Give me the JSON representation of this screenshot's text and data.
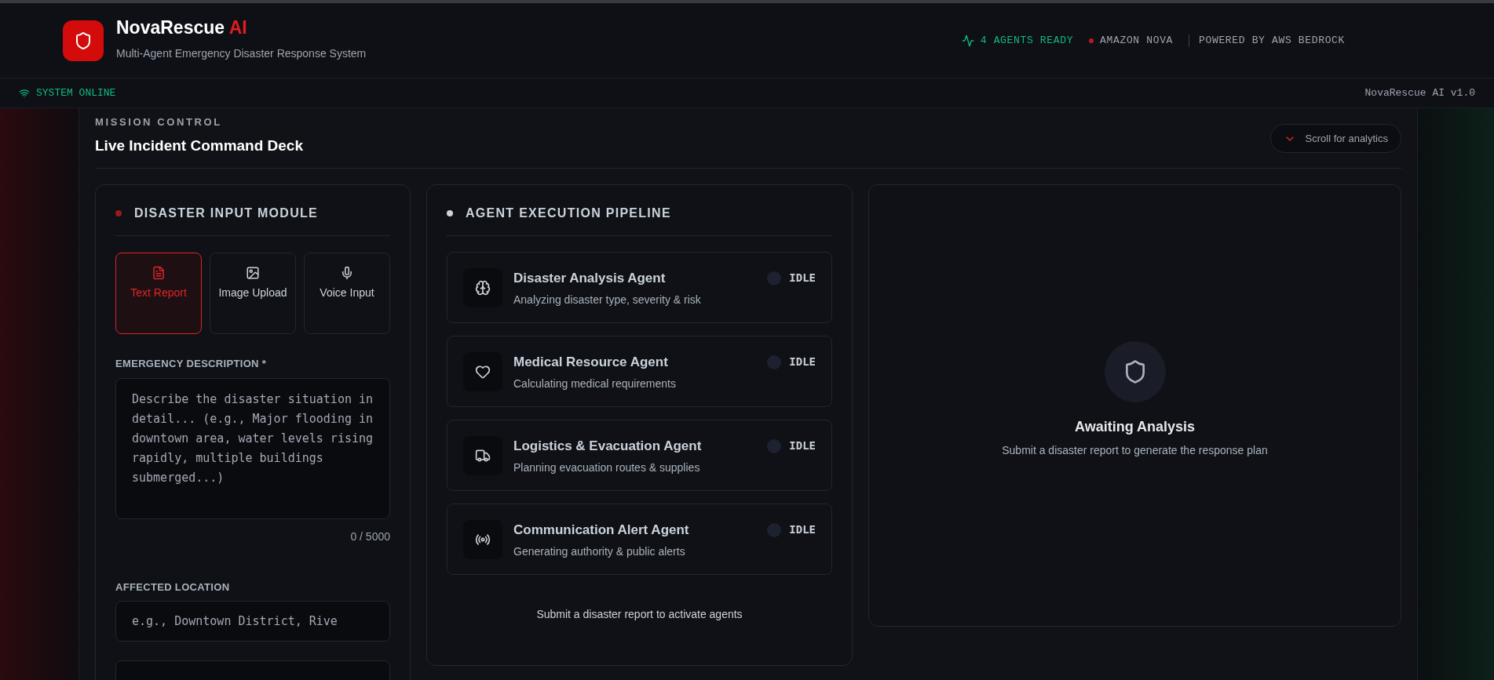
{
  "header": {
    "brand": {
      "main": "NovaRescue",
      "accent": "AI"
    },
    "subtitle": "Multi-Agent Emergency Disaster Response System",
    "badges": [
      {
        "kind": "activity",
        "label": "4 AGENTS READY"
      },
      {
        "kind": "dot",
        "label": "AMAZON NOVA"
      },
      {
        "kind": "plain",
        "label": "POWERED BY AWS BEDROCK"
      }
    ]
  },
  "status_bar": {
    "status": "SYSTEM ONLINE",
    "version": "NovaRescue AI v1.0"
  },
  "mission": {
    "eyebrow": "MISSION CONTROL",
    "title": "Live Incident Command Deck",
    "scroll_button": "Scroll for analytics"
  },
  "input_module": {
    "title": "DISASTER INPUT MODULE",
    "modes": [
      {
        "kind": "text",
        "label": "Text Report",
        "selected": true
      },
      {
        "kind": "image",
        "label": "Image Upload",
        "selected": false
      },
      {
        "kind": "voice",
        "label": "Voice Input",
        "selected": false
      }
    ],
    "description": {
      "label": "EMERGENCY DESCRIPTION *",
      "placeholder": "Describe the disaster situation in detail... (e.g., Major flooding in downtown area, water levels rising rapidly, multiple buildings submerged...)",
      "counter": "0 / 5000"
    },
    "location": {
      "label": "AFFECTED LOCATION",
      "placeholder": "e.g., Downtown District, Rive"
    }
  },
  "pipeline": {
    "title": "AGENT EXECUTION PIPELINE",
    "agents": [
      {
        "kind": "brain",
        "name": "Disaster Analysis Agent",
        "task": "Analyzing disaster type, severity & risk",
        "status": "IDLE"
      },
      {
        "kind": "heart",
        "name": "Medical Resource Agent",
        "task": "Calculating medical requirements",
        "status": "IDLE"
      },
      {
        "kind": "truck",
        "name": "Logistics & Evacuation Agent",
        "task": "Planning evacuation routes & supplies",
        "status": "IDLE"
      },
      {
        "kind": "radio",
        "name": "Communication Alert Agent",
        "task": "Generating authority & public alerts",
        "status": "IDLE"
      }
    ],
    "hint": "Submit a disaster report to activate agents"
  },
  "result": {
    "title": "Awaiting Analysis",
    "message": "Submit a disaster report to generate the response plan"
  }
}
